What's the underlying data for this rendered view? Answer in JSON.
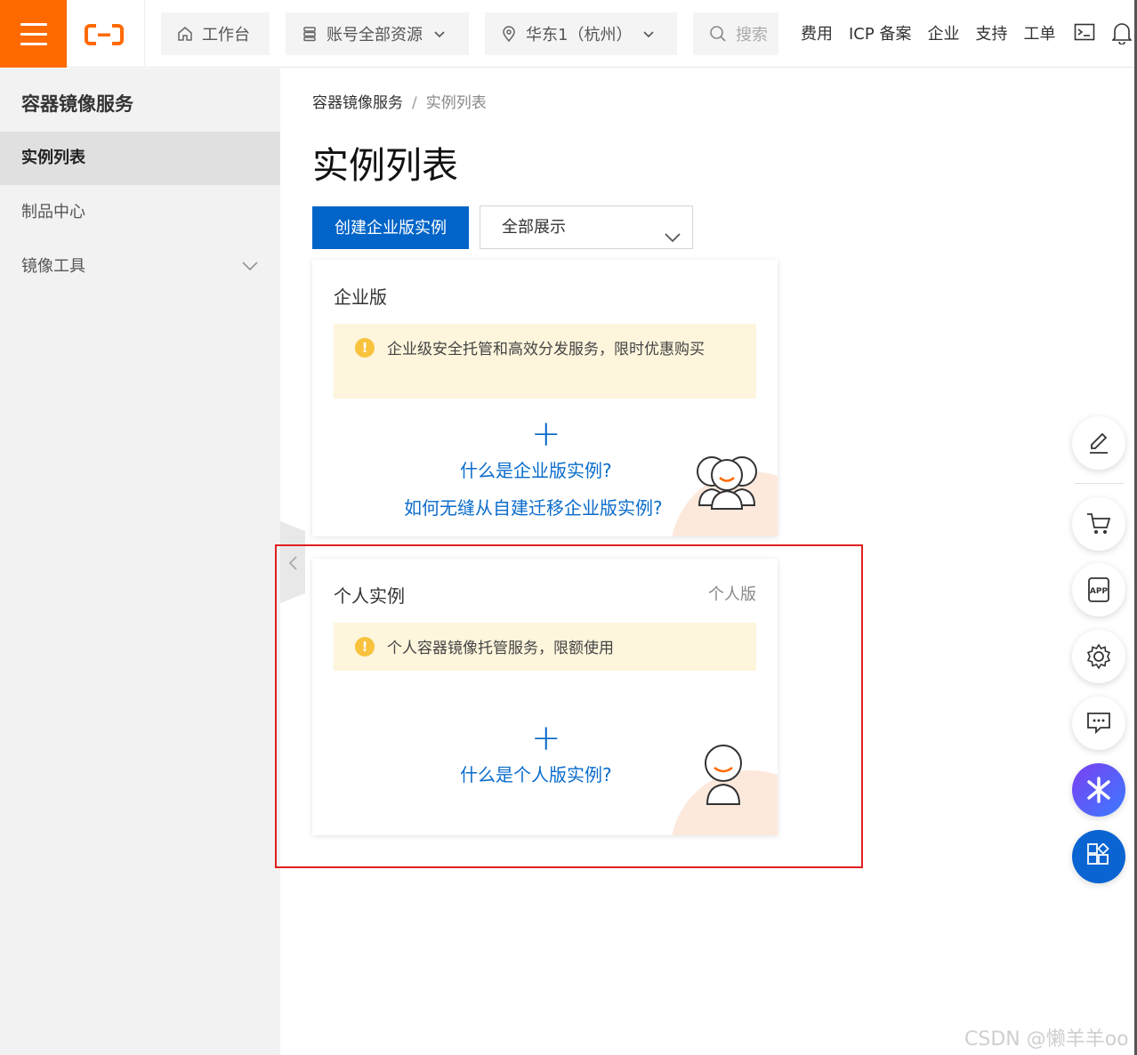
{
  "topbar": {
    "home_label": "工作台",
    "resources_label": "账号全部资源",
    "region_label": "华东1（杭州）",
    "search_placeholder": "搜索",
    "links": [
      "费用",
      "ICP 备案",
      "企业",
      "支持",
      "工单"
    ]
  },
  "sidebar": {
    "title": "容器镜像服务",
    "items": [
      {
        "label": "实例列表",
        "active": true
      },
      {
        "label": "制品中心",
        "active": false
      },
      {
        "label": "镜像工具",
        "active": false
      }
    ]
  },
  "breadcrumb": {
    "root": "容器镜像服务",
    "sep": "/",
    "current": "实例列表"
  },
  "page": {
    "title": "实例列表",
    "create_button": "创建企业版实例",
    "filter_select": "全部展示"
  },
  "cards": {
    "enterprise": {
      "title": "企业版",
      "notice": "企业级安全托管和高效分发服务，限时优惠购买",
      "plus": "+",
      "link1": "什么是企业版实例?",
      "link2": "如何无缝从自建迁移企业版实例?"
    },
    "personal": {
      "title": "个人实例",
      "tag": "个人版",
      "notice": "个人容器镜像托管服务，限额使用",
      "plus": "+",
      "link1": "什么是个人版实例?"
    }
  },
  "watermark": "CSDN @懒羊羊oo",
  "colors": {
    "brand": "#ff6a00",
    "primary": "#0064c8",
    "link": "#0a6ccb",
    "notice_bg": "#fdf5dc",
    "highlight": "#e02020"
  }
}
